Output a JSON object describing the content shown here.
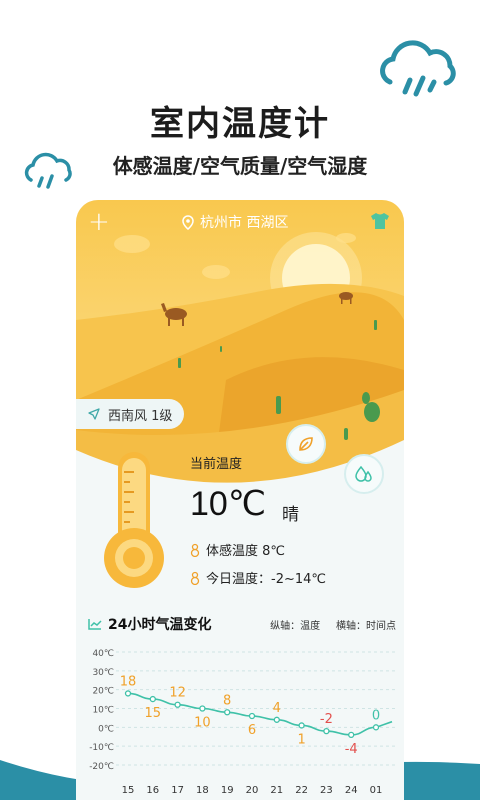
{
  "hero": {
    "title": "室内温度计",
    "subtitle": "体感温度/空气质量/空气湿度"
  },
  "topbar": {
    "add": "+",
    "location": "杭州市 西湖区"
  },
  "wind": {
    "text": "西南风 1级"
  },
  "current": {
    "label": "当前温度",
    "temp": "10℃",
    "weather": "晴",
    "feels": "体感温度 8℃",
    "today": "今日温度：-2~14℃"
  },
  "chart_header": {
    "title": "24小时气温变化",
    "axis_note": "纵轴：温度     横轴：时间点"
  },
  "colors": {
    "accent": "#f5b93a",
    "teal": "#2b8fa6",
    "line": "#3fc1a8",
    "label_orange": "#f0a12a",
    "label_red": "#e2504d"
  },
  "chart_data": {
    "type": "line",
    "x": [
      "15",
      "16",
      "17",
      "18",
      "19",
      "20",
      "21",
      "22",
      "23",
      "24",
      "01"
    ],
    "y": [
      18,
      15,
      12,
      10,
      8,
      6,
      4,
      1,
      -2,
      -4,
      0
    ],
    "y_ticks": [
      "40℃",
      "30℃",
      "20℃",
      "10℃",
      "0℃",
      "-10℃",
      "-20℃"
    ],
    "ylim": [
      -20,
      40
    ],
    "grid": true
  }
}
